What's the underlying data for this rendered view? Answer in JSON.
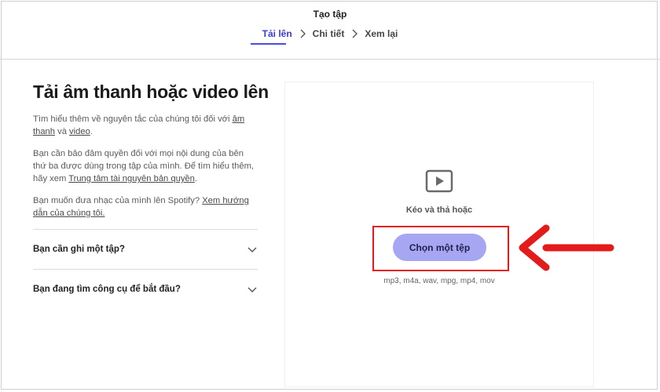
{
  "header": {
    "title": "Tạo tập",
    "steps": [
      "Tải lên",
      "Chi tiết",
      "Xem lại"
    ]
  },
  "left": {
    "title": "Tải âm thanh hoặc video lên",
    "p1_text": "Tìm hiểu thêm về nguyên tắc của chúng tôi đối với ",
    "p1_link1": "âm thanh",
    "p1_and": " và ",
    "p1_link2": "video",
    "p1_end": ".",
    "p2_text": "Bạn cần bảo đảm quyền đối với mọi nội dung của bên thứ ba được dùng trong tập của mình. Để tìm hiểu thêm, hãy xem ",
    "p2_link": "Trung tâm tài nguyên bản quyền",
    "p2_end": ".",
    "p3_text": "Bạn muốn đưa nhạc của mình lên Spotify? ",
    "p3_link": "Xem hướng dẫn của chúng tôi.",
    "accordions": [
      "Bạn cần ghi một tập?",
      "Bạn đang tìm công cụ để bắt đầu?"
    ]
  },
  "upload": {
    "drag_text": "Kéo và thả hoặc",
    "button_label": "Chọn một tệp",
    "formats": "mp3, m4a, wav, mpg, mp4, mov"
  },
  "colors": {
    "accent": "#4b4be0",
    "button_bg": "#a7a6f3",
    "annotation_red": "#e41b1b"
  },
  "icons": {
    "play": "play-icon",
    "chevron_right": "chevron-right-icon",
    "chevron_down": "chevron-down-icon",
    "annotation_arrow": "left-arrow-annotation"
  }
}
